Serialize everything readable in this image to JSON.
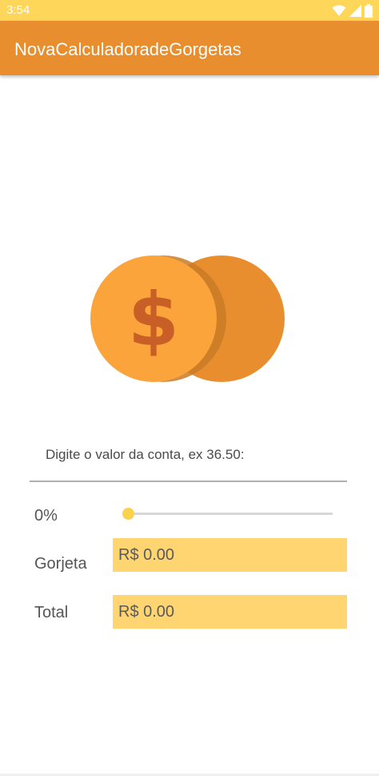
{
  "status_bar": {
    "time": "3:54",
    "icons": [
      "wifi-icon",
      "signal-icon",
      "battery-icon"
    ]
  },
  "app_bar": {
    "title": "NovaCalculadoradeGorgetas"
  },
  "illustration": {
    "icon": "coins-dollar-icon",
    "colors": {
      "front_coin": "#fba43c",
      "back_coin": "#e98e2e",
      "dollar_sign": "#c85f26"
    }
  },
  "form": {
    "prompt": "Digite o valor da conta, ex 36.50:",
    "bill_value": ""
  },
  "tip": {
    "percent_label": "0%",
    "slider_value": 0
  },
  "results": {
    "gorjeta_label": "Gorjeta",
    "gorjeta_value": "R$ 0.00",
    "total_label": "Total",
    "total_value": "R$ 0.00"
  },
  "colors": {
    "primary": "#e98e2e",
    "status_bar": "#fdd65a",
    "value_box": "#fed570",
    "slider_thumb": "#fbd24c"
  }
}
